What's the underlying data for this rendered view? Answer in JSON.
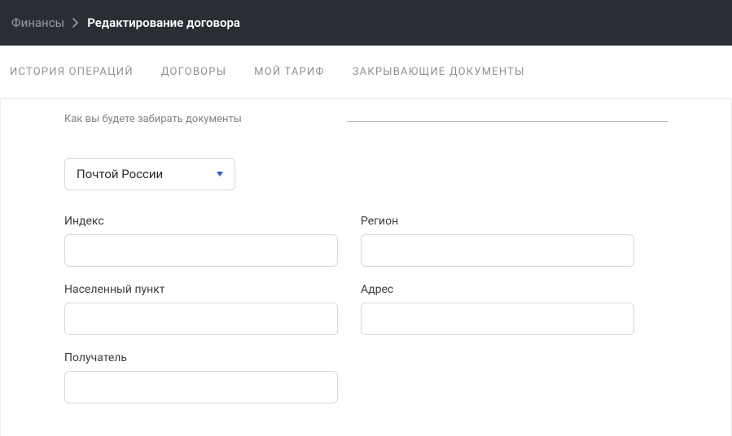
{
  "breadcrumb": {
    "parent": "Финансы",
    "current": "Редактирование договора"
  },
  "tabs": {
    "history": "ИСТОРИЯ ОПЕРАЦИЙ",
    "contracts": "ДОГОВОРЫ",
    "tariff": "МОЙ ТАРИФ",
    "closing_docs": "ЗАКРЫВАЮЩИЕ ДОКУМЕНТЫ"
  },
  "form": {
    "subtitle": "Как вы будете забирать документы",
    "delivery_select": {
      "selected": "Почтой России"
    },
    "fields": {
      "index": {
        "label": "Индекс",
        "value": ""
      },
      "region": {
        "label": "Регион",
        "value": ""
      },
      "locality": {
        "label": "Населенный пункт",
        "value": ""
      },
      "address": {
        "label": "Адрес",
        "value": ""
      },
      "recipient": {
        "label": "Получатель",
        "value": ""
      }
    }
  }
}
